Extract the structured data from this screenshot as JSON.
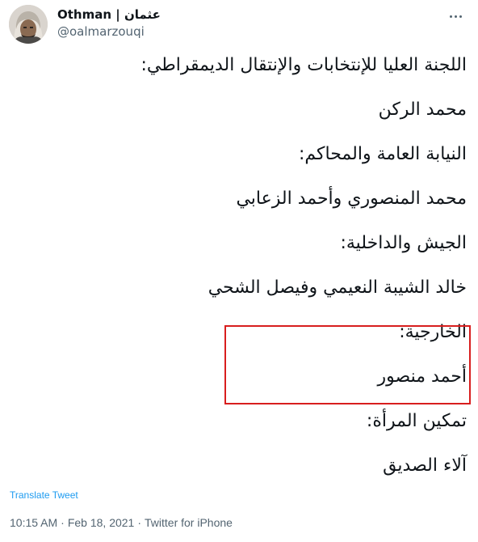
{
  "author": {
    "display_name": "Othman | عثمان",
    "handle": "@oalmarzouqi",
    "avatar_icon": "profile-photo-avatar"
  },
  "menu": {
    "icon": "more-horizontal-icon"
  },
  "tweet": {
    "lines": [
      "اللجنة العليا للإنتخابات والإنتقال الديمقراطي:",
      "محمد الركن",
      "النيابة العامة والمحاكم:",
      "محمد المنصوري وأحمد الزعابي",
      "الجيش والداخلية:",
      "خالد الشيبة النعيمي وفيصل الشحي",
      "الخارجية:",
      "أحمد منصور",
      "تمكين المرأة:",
      "آلاء الصديق"
    ],
    "highlight_color": "#d81e1e"
  },
  "translate_label": "Translate Tweet",
  "meta": {
    "time": "10:15 AM",
    "separator": "·",
    "date": "Feb 18, 2021",
    "source": "Twitter for iPhone"
  },
  "colors": {
    "text": "#0f1419",
    "secondary": "#536471",
    "link": "#1d9bf0"
  }
}
